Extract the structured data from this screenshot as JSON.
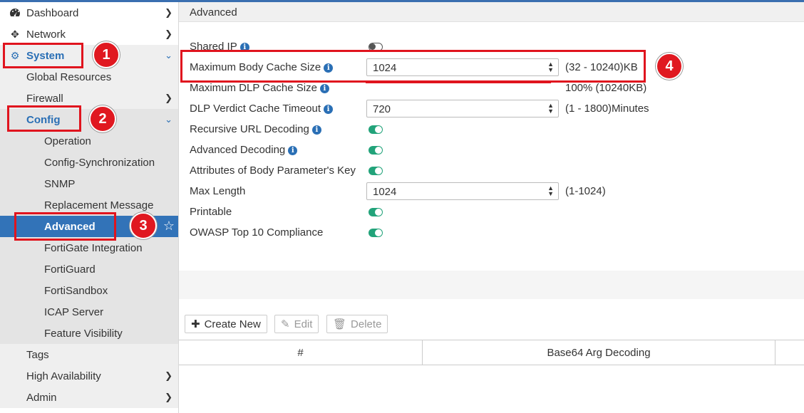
{
  "sidebar": {
    "items": [
      {
        "label": "Dashboard",
        "icon": "dashboard-icon",
        "chevron": "›"
      },
      {
        "label": "Network",
        "icon": "move-arrows-icon",
        "chevron": "›"
      },
      {
        "label": "System",
        "icon": "gear-icon",
        "chevron": "⌄"
      },
      {
        "label": "Global Resources"
      },
      {
        "label": "Firewall",
        "chevron": "›"
      },
      {
        "label": "Config",
        "chevron": "⌄"
      },
      {
        "label": "Operation"
      },
      {
        "label": "Config-Synchronization"
      },
      {
        "label": "SNMP"
      },
      {
        "label": "Replacement Message"
      },
      {
        "label": "Advanced"
      },
      {
        "label": "FortiGate Integration"
      },
      {
        "label": "FortiGuard"
      },
      {
        "label": "FortiSandbox"
      },
      {
        "label": "ICAP Server"
      },
      {
        "label": "Feature Visibility"
      },
      {
        "label": "Tags"
      },
      {
        "label": "High Availability",
        "chevron": "›"
      },
      {
        "label": "Admin",
        "chevron": "›"
      }
    ]
  },
  "header": {
    "title": "Advanced"
  },
  "settings": {
    "shared_ip": {
      "label": "Shared IP",
      "enabled": false
    },
    "max_body_cache": {
      "label": "Maximum Body Cache Size",
      "value": "1024",
      "range": "(32 - 10240)KB"
    },
    "max_dlp_cache": {
      "label": "Maximum DLP Cache Size",
      "range": "100% (10240KB)"
    },
    "dlp_verdict_timeout": {
      "label": "DLP Verdict Cache Timeout",
      "value": "720",
      "range": "(1 - 1800)Minutes"
    },
    "recursive_url": {
      "label": "Recursive URL Decoding",
      "enabled": true
    },
    "advanced_decoding": {
      "label": "Advanced Decoding",
      "enabled": true
    },
    "attr_body_param": {
      "label": "Attributes of Body Parameter's Key",
      "enabled": true
    },
    "max_length": {
      "label": "Max Length",
      "value": "1024",
      "range": "(1-1024)"
    },
    "printable": {
      "label": "Printable",
      "enabled": true
    },
    "owasp": {
      "label": "OWASP Top 10 Compliance",
      "enabled": true
    }
  },
  "toolbar": {
    "create_new": "Create New",
    "edit": "Edit",
    "delete": "Delete"
  },
  "table": {
    "columns": [
      "#",
      "Base64 Arg Decoding"
    ]
  },
  "annotations": {
    "badges": [
      "1",
      "2",
      "3",
      "4"
    ]
  },
  "colors": {
    "accent": "#3273b8",
    "toggle_on": "#22a37a",
    "annotation_red": "#e0141e"
  }
}
